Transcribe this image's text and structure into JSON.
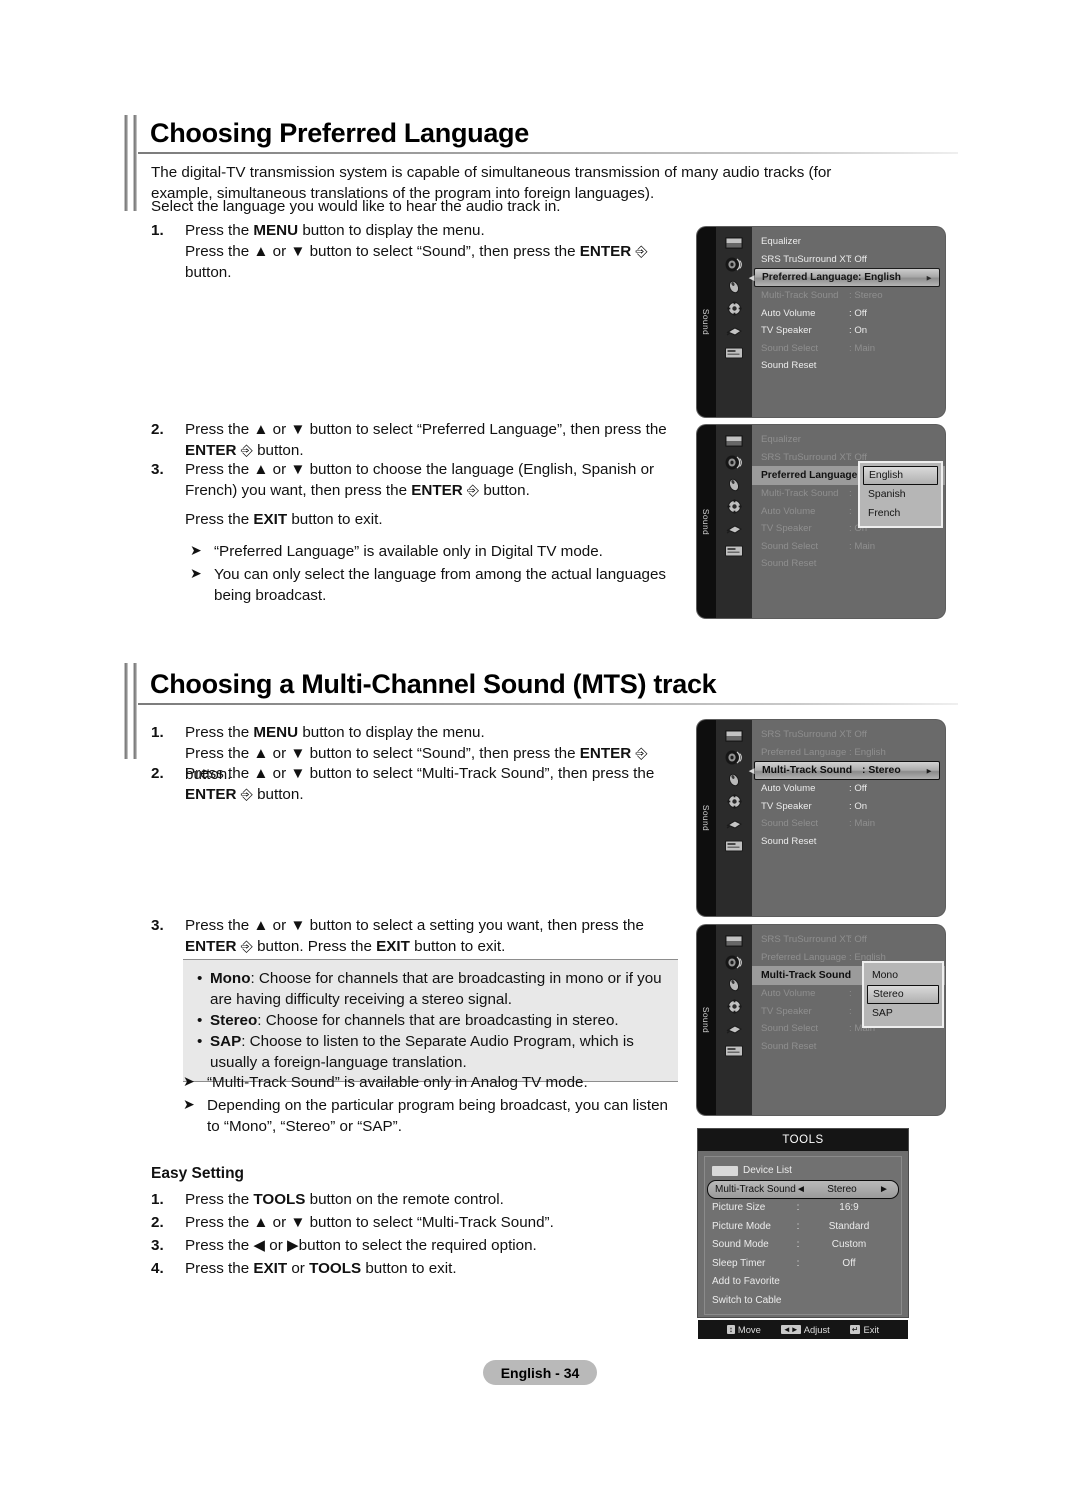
{
  "section1": {
    "heading": "Choosing Preferred Language",
    "intro": "The digital-TV transmission system is capable of simultaneous transmission of many audio tracks (for example, simultaneous translations of the program into foreign languages).",
    "intro2": "Select the language you would like to hear the audio track in.",
    "steps": [
      {
        "num": "1.",
        "line1_a": "Press the ",
        "line1_b": "MENU",
        "line1_c": " button to display the menu.",
        "line2": "Press the ▲ or ▼ button to select “Sound”, then press the ENTER ↵ button."
      },
      {
        "num": "2.",
        "text": "Press the ▲ or ▼ button to select “Preferred Language”, then press the ENTER ↵ button."
      },
      {
        "num": "3.",
        "text": "Press the ▲ or ▼ button to choose the language (English, Spanish or French) you want, then press the ENTER ↵ button.",
        "extra": "Press the EXIT button to exit."
      }
    ],
    "notes": [
      "“Preferred Language” is available only in Digital TV mode.",
      "You can only select the language from among the actual languages being broadcast."
    ]
  },
  "section2": {
    "heading": "Choosing a Multi-Channel Sound (MTS) track",
    "steps": [
      {
        "num": "1.",
        "line1": "Press the MENU button to display the menu.",
        "line2": "Press the ▲ or ▼ button to select “Sound”, then press the ENTER ↵ button."
      },
      {
        "num": "2.",
        "text": "Press the ▲ or ▼ button to select “Multi-Track Sound”, then press the ENTER ↵ button."
      },
      {
        "num": "3.",
        "text": "Press the ▲ or ▼ button to select a setting you want, then press the ENTER ↵ button. Press the EXIT button to exit."
      }
    ],
    "bullets": [
      {
        "term": "Mono",
        "desc": ": Choose for channels that are broadcasting in mono or if you are having difficulty receiving a stereo signal."
      },
      {
        "term": "Stereo",
        "desc": ": Choose for channels that are broadcasting in stereo."
      },
      {
        "term": "SAP",
        "desc": ": Choose to listen to the Separate Audio Program, which is usually a foreign-language translation."
      }
    ],
    "notes": [
      "“Multi-Track Sound” is available only in Analog TV mode.",
      "Depending on the particular program being broadcast, you can listen to “Mono”, “Stereo” or “SAP”."
    ]
  },
  "easy_setting": {
    "title": "Easy Setting",
    "steps": [
      {
        "num": "1.",
        "text": "Press the TOOLS button on the remote control."
      },
      {
        "num": "2.",
        "text": "Press the ▲ or ▼ button to select “Multi-Track Sound”."
      },
      {
        "num": "3.",
        "text": "Press the ◄ or ► button to select the required option."
      },
      {
        "num": "4.",
        "text": "Press the EXIT or TOOLS button to exit."
      }
    ]
  },
  "osd": {
    "rail_label": "Sound",
    "panel1": {
      "rows": [
        {
          "label": "Equalizer",
          "value": "",
          "state": "norm"
        },
        {
          "label": "SRS TruSurround XT",
          "value": ": Off",
          "state": "norm"
        },
        {
          "label": "Preferred Language",
          "value": ": English",
          "state": "highlight",
          "arrow": "►"
        },
        {
          "label": "Multi-Track Sound",
          "value": ": Stereo",
          "state": "dim"
        },
        {
          "label": "Auto Volume",
          "value": ": Off",
          "state": "norm"
        },
        {
          "label": "TV Speaker",
          "value": ": On",
          "state": "norm"
        },
        {
          "label": "Sound Select",
          "value": ": Main",
          "state": "dim"
        },
        {
          "label": "Sound Reset",
          "value": "",
          "state": "norm"
        }
      ]
    },
    "panel2": {
      "rows": [
        {
          "label": "Equalizer",
          "value": "",
          "state": "dim"
        },
        {
          "label": "SRS TruSurround XT",
          "value": ": Off",
          "state": "dim"
        },
        {
          "label": "Preferred Language",
          "value": ":",
          "state": "active"
        },
        {
          "label": "Multi-Track Sound",
          "value": ":",
          "state": "dim"
        },
        {
          "label": "Auto Volume",
          "value": ":",
          "state": "dim"
        },
        {
          "label": "TV Speaker",
          "value": ": On",
          "state": "dim"
        },
        {
          "label": "Sound Select",
          "value": ": Main",
          "state": "dim"
        },
        {
          "label": "Sound Reset",
          "value": "",
          "state": "dim"
        }
      ],
      "dropdown": {
        "options": [
          "English",
          "Spanish",
          "French"
        ],
        "selected": "English"
      }
    },
    "panel3": {
      "rows": [
        {
          "label": "SRS TruSurround XT",
          "value": ": Off",
          "state": "dim"
        },
        {
          "label": "Preferred Language",
          "value": ": English",
          "state": "dim"
        },
        {
          "label": "Multi-Track Sound",
          "value": ": Stereo",
          "state": "highlight",
          "arrow": "►"
        },
        {
          "label": "Auto Volume",
          "value": ": Off",
          "state": "norm"
        },
        {
          "label": "TV Speaker",
          "value": ": On",
          "state": "norm"
        },
        {
          "label": "Sound Select",
          "value": ": Main",
          "state": "dim"
        },
        {
          "label": "Sound Reset",
          "value": "",
          "state": "norm"
        }
      ]
    },
    "panel4": {
      "rows": [
        {
          "label": "SRS TruSurround XT",
          "value": ": Off",
          "state": "dim"
        },
        {
          "label": "Preferred Language",
          "value": ": English",
          "state": "dim"
        },
        {
          "label": "Multi-Track Sound",
          "value": ":",
          "state": "active"
        },
        {
          "label": "Auto Volume",
          "value": ":",
          "state": "dim"
        },
        {
          "label": "TV Speaker",
          "value": ":",
          "state": "dim"
        },
        {
          "label": "Sound Select",
          "value": ": Main",
          "state": "dim"
        },
        {
          "label": "Sound Reset",
          "value": "",
          "state": "dim"
        }
      ],
      "dropdown": {
        "options": [
          "Mono",
          "Stereo",
          "SAP"
        ],
        "selected": "Stereo"
      }
    }
  },
  "tools": {
    "title": "TOOLS",
    "rows": [
      {
        "label": "Device List",
        "sep": "",
        "value": "",
        "icon": "anynet-logo"
      },
      {
        "label": "Multi-Track Sound",
        "sep": "◄",
        "value": "Stereo",
        "right": "►",
        "selected": true
      },
      {
        "label": "Picture Size",
        "sep": ":",
        "value": "16:9"
      },
      {
        "label": "Picture Mode",
        "sep": ":",
        "value": "Standard"
      },
      {
        "label": "Sound Mode",
        "sep": ":",
        "value": "Custom"
      },
      {
        "label": "Sleep Timer",
        "sep": ":",
        "value": "Off"
      },
      {
        "label": "Add to Favorite",
        "sep": "",
        "value": ""
      },
      {
        "label": "Switch to Cable",
        "sep": "",
        "value": ""
      }
    ],
    "footer": [
      {
        "key": "↕",
        "label": "Move"
      },
      {
        "key": "◄►",
        "label": "Adjust"
      },
      {
        "key": "↵",
        "label": "Exit"
      }
    ]
  },
  "footer": {
    "page_label": "English - 34"
  }
}
